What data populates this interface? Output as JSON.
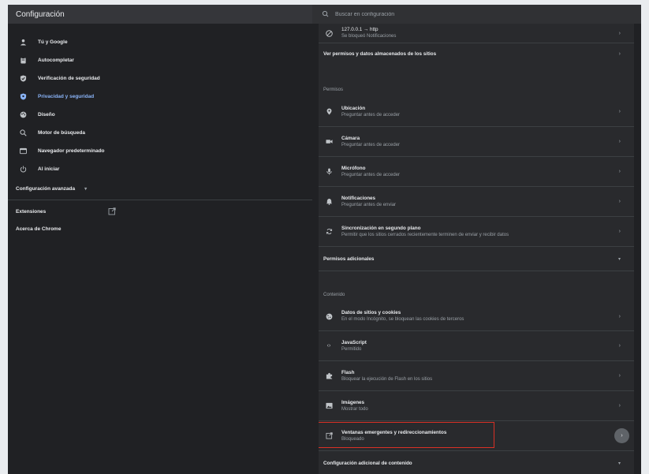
{
  "header": {
    "title": "Configuración",
    "search_placeholder": "Buscar en configuración"
  },
  "sidebar": {
    "items": [
      {
        "label": "Tú y Google",
        "icon": "person-icon"
      },
      {
        "label": "Autocompletar",
        "icon": "clipboard-icon"
      },
      {
        "label": "Verificación de seguridad",
        "icon": "shield-check-icon"
      },
      {
        "label": "Privacidad y seguridad",
        "icon": "shield-icon"
      },
      {
        "label": "Diseño",
        "icon": "palette-icon"
      },
      {
        "label": "Motor de búsqueda",
        "icon": "search-icon"
      },
      {
        "label": "Navegador predeterminado",
        "icon": "browser-icon"
      },
      {
        "label": "Al iniciar",
        "icon": "power-icon"
      }
    ],
    "advanced_label": "Configuración avanzada",
    "extensions_label": "Extensiones",
    "about_label": "Acerca de Chrome",
    "active_color": "#8ab4f8"
  },
  "main": {
    "top_site": {
      "title": "127.0.0.1 → http",
      "subtitle": "Se bloqueó Notificaciones"
    },
    "view_permissions": "Ver permisos y datos almacenados de los sitios",
    "permissions_header": "Permisos",
    "permissions": [
      {
        "title": "Ubicación",
        "subtitle": "Preguntar antes de acceder",
        "icon": "location-icon"
      },
      {
        "title": "Cámara",
        "subtitle": "Preguntar antes de acceder",
        "icon": "camera-icon"
      },
      {
        "title": "Micrófono",
        "subtitle": "Preguntar antes de acceder",
        "icon": "microphone-icon"
      },
      {
        "title": "Notificaciones",
        "subtitle": "Preguntar antes de enviar",
        "icon": "bell-icon"
      },
      {
        "title": "Sincronización en segundo plano",
        "subtitle": "Permitir que los sitios cerrados recientemente terminen de enviar y recibir datos",
        "icon": "sync-icon"
      }
    ],
    "additional_permissions": "Permisos adicionales",
    "content_header": "Contenido",
    "content": [
      {
        "title": "Datos de sitios y cookies",
        "subtitle": "En el modo Incógnito, se bloquean las cookies de terceros",
        "icon": "cookie-icon"
      },
      {
        "title": "JavaScript",
        "subtitle": "Permitido",
        "icon": "code-icon"
      },
      {
        "title": "Flash",
        "subtitle": "Bloquear la ejecución de Flash en los sitios",
        "icon": "puzzle-icon"
      },
      {
        "title": "Imágenes",
        "subtitle": "Mostrar todo",
        "icon": "image-icon"
      },
      {
        "title": "Ventanas emergentes y redireccionamientos",
        "subtitle": "Bloqueado",
        "icon": "open-in-new-icon"
      }
    ],
    "additional_content": "Configuración adicional de contenido",
    "highlight_color": "#d93025"
  }
}
